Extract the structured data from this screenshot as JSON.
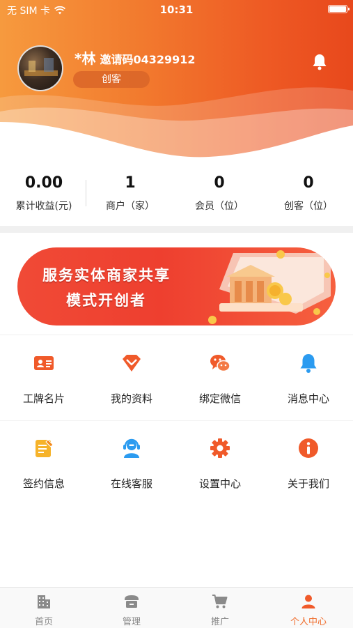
{
  "status_bar": {
    "carrier": "无 SIM 卡",
    "time": "10:31"
  },
  "profile": {
    "name": "*林",
    "invite": "邀请码04329912",
    "role": "创客"
  },
  "stats": [
    {
      "value": "0.00",
      "label": "累计收益(元)"
    },
    {
      "value": "1",
      "label": "商户（家）"
    },
    {
      "value": "0",
      "label": "会员（位）"
    },
    {
      "value": "0",
      "label": "创客（位）"
    }
  ],
  "banner": {
    "line1": "服务实体商家共享",
    "line2": "模式开创者"
  },
  "menu": [
    {
      "label": "工牌名片",
      "icon": "id-card-icon"
    },
    {
      "label": "我的资料",
      "icon": "diamond-icon"
    },
    {
      "label": "绑定微信",
      "icon": "wechat-icon"
    },
    {
      "label": "消息中心",
      "icon": "bell-icon"
    },
    {
      "label": "签约信息",
      "icon": "contract-icon"
    },
    {
      "label": "在线客服",
      "icon": "headset-icon"
    },
    {
      "label": "设置中心",
      "icon": "gear-icon"
    },
    {
      "label": "关于我们",
      "icon": "info-icon"
    }
  ],
  "tabs": [
    {
      "label": "首页",
      "icon": "building-icon"
    },
    {
      "label": "管理",
      "icon": "store-icon"
    },
    {
      "label": "推广",
      "icon": "cart-icon"
    },
    {
      "label": "个人中心",
      "icon": "person-icon"
    }
  ],
  "colors": {
    "accent": "#f06a28",
    "header_start": "#f69a3e",
    "header_end": "#e8481c",
    "tab_inactive": "#888888"
  }
}
